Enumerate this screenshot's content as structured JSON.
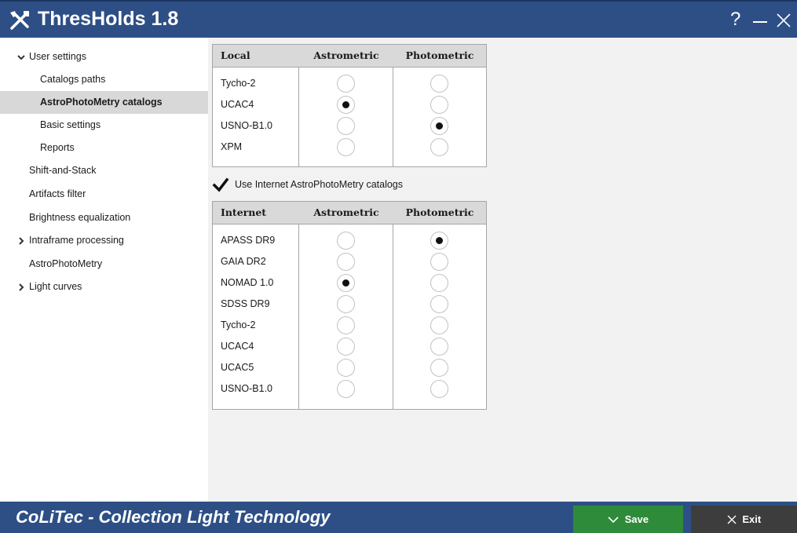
{
  "app": {
    "title": "ThresHolds 1.8",
    "icon": "tools-icon",
    "help_label": "?"
  },
  "sidebar": {
    "items": [
      {
        "label": "User settings",
        "level": "top",
        "arrow": "expanded"
      },
      {
        "label": "Catalogs paths",
        "level": "sub"
      },
      {
        "label": "AstroPhotoMetry catalogs",
        "level": "sub",
        "selected": true
      },
      {
        "label": "Basic settings",
        "level": "sub"
      },
      {
        "label": "Reports",
        "level": "sub"
      },
      {
        "label": "Shift-and-Stack",
        "level": "top"
      },
      {
        "label": "Artifacts filter",
        "level": "top"
      },
      {
        "label": "Brightness equalization",
        "level": "top"
      },
      {
        "label": "Intraframe processing",
        "level": "top",
        "arrow": "collapsed"
      },
      {
        "label": "AstroPhotoMetry",
        "level": "top"
      },
      {
        "label": "Light curves",
        "level": "top",
        "arrow": "collapsed"
      }
    ]
  },
  "local_table": {
    "headers": [
      "Local",
      "Astrometric",
      "Photometric"
    ],
    "rows": [
      {
        "name": "Tycho-2",
        "astrometric": false,
        "photometric": false
      },
      {
        "name": "UCAC4",
        "astrometric": true,
        "photometric": false
      },
      {
        "name": "USNO-B1.0",
        "astrometric": false,
        "photometric": true
      },
      {
        "name": "XPM",
        "astrometric": false,
        "photometric": false
      }
    ]
  },
  "use_internet": {
    "label": "Use Internet AstroPhotoMetry catalogs",
    "checked": true
  },
  "internet_table": {
    "headers": [
      "Internet",
      "Astrometric",
      "Photometric"
    ],
    "rows": [
      {
        "name": "APASS DR9",
        "astrometric": false,
        "photometric": true
      },
      {
        "name": "GAIA DR2",
        "astrometric": false,
        "photometric": false
      },
      {
        "name": "NOMAD 1.0",
        "astrometric": true,
        "photometric": false
      },
      {
        "name": "SDSS DR9",
        "astrometric": false,
        "photometric": false
      },
      {
        "name": "Tycho-2",
        "astrometric": false,
        "photometric": false
      },
      {
        "name": "UCAC4",
        "astrometric": false,
        "photometric": false
      },
      {
        "name": "UCAC5",
        "astrometric": false,
        "photometric": false
      },
      {
        "name": "USNO-B1.0",
        "astrometric": false,
        "photometric": false
      }
    ]
  },
  "footer": {
    "brand": "CoLiTec - Collection Light Technology",
    "save_label": "Save",
    "exit_label": "Exit"
  },
  "colors": {
    "title_bar": "#2d4f86",
    "save_button": "#2e8b3a",
    "exit_button": "#3d3d3d",
    "selected_item": "#d8d8d8"
  }
}
